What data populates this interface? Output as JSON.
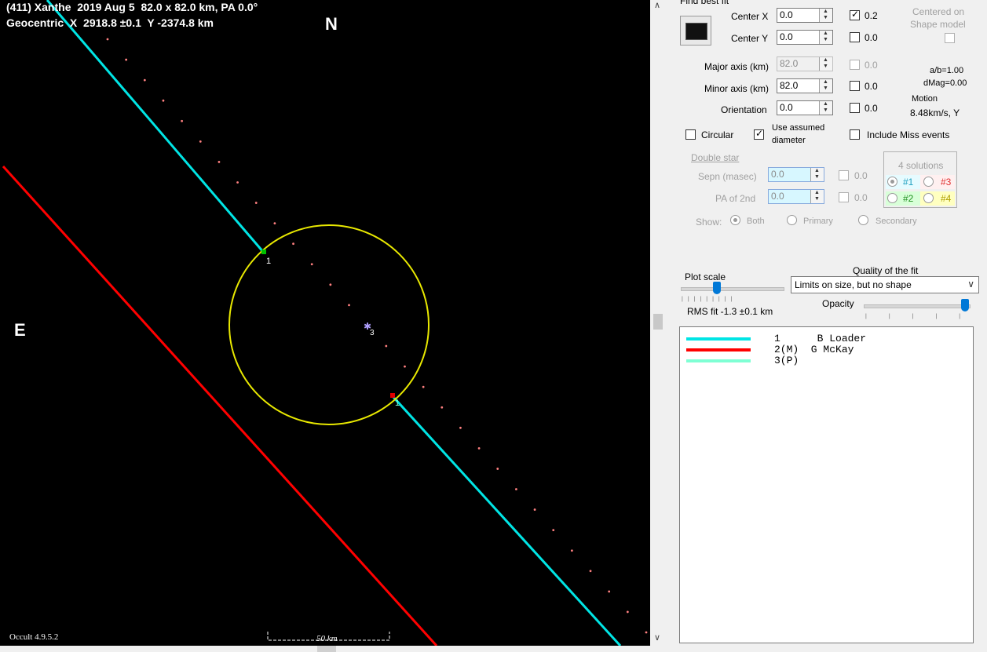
{
  "plot": {
    "title_line1": "(411) Xanthe  2019 Aug 5  82.0 x 82.0 km, PA 0.0°",
    "title_line2": "Geocentric  X  2918.8 ±0.1  Y -2374.8 km",
    "north_label": "N",
    "east_label": "E",
    "version": "Occult 4.9.5.2",
    "scale_label": "50 km",
    "chord_labels": [
      "1",
      "1",
      "3"
    ],
    "colors": {
      "background": "#000000",
      "ellipse": "#ffff00",
      "chord1": "#00e5e5",
      "chord2": "#ff0000",
      "dots": "#ff8080"
    }
  },
  "panel": {
    "find_best_fit": "Find best fit",
    "center_x": {
      "label": "Center X",
      "value": "0.0",
      "check_value": "0.2",
      "checked": true
    },
    "center_y": {
      "label": "Center Y",
      "value": "0.0",
      "check_value": "0.0",
      "checked": false
    },
    "major_axis": {
      "label": "Major axis (km)",
      "value": "82.0",
      "check_value": "0.0"
    },
    "minor_axis": {
      "label": "Minor axis (km)",
      "value": "82.0",
      "check_value": "0.0"
    },
    "orientation": {
      "label": "Orientation",
      "value": "0.0",
      "check_value": "0.0"
    },
    "centered_on": "Centered on",
    "shape_model": "Shape model",
    "ab_ratio": "a/b=1.00",
    "dmag": "dMag=0.00",
    "motion_label": "Motion",
    "motion_value": "8.48km/s, Y",
    "circular": "Circular",
    "use_assumed_1": "Use assumed",
    "use_assumed_2": "diameter",
    "include_miss": "Include Miss events",
    "double_star": "Double star",
    "sepn": {
      "label": "Sepn (masec)",
      "value": "0.0",
      "check_value": "0.0"
    },
    "pa2nd": {
      "label": "PA of 2nd",
      "value": "0.0",
      "check_value": "0.0"
    },
    "show_label": "Show:",
    "show_both": "Both",
    "show_primary": "Primary",
    "show_secondary": "Secondary",
    "solutions_title": "4 solutions",
    "solutions": [
      "#1",
      "#3",
      "#2",
      "#4"
    ],
    "plot_scale": "Plot scale",
    "quality_label": "Quality of the fit",
    "quality_value": "Limits on size, but no shape",
    "opacity": "Opacity",
    "rms_fit": "RMS fit -1.3 ±0.1 km"
  },
  "legend": [
    {
      "text": "1      B Loader",
      "color": "#00e5e5"
    },
    {
      "text": "2(M)  G McKay",
      "color": "#ff0000"
    },
    {
      "text": "3(P)",
      "color": "#7fffd4"
    }
  ]
}
